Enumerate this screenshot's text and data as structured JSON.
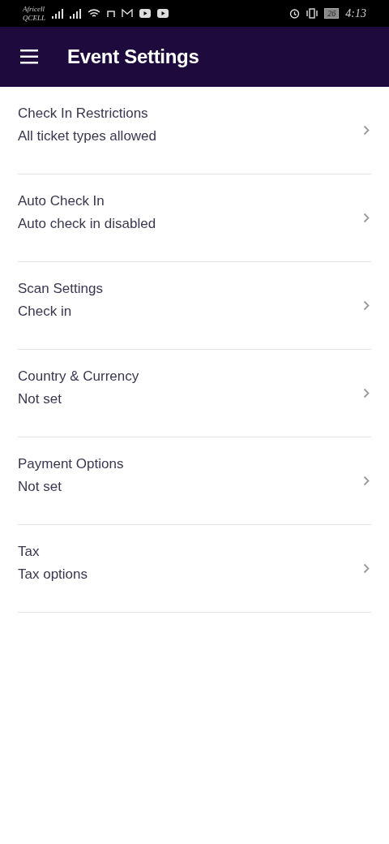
{
  "status_bar": {
    "carriers": [
      "Africell",
      "QCELL"
    ],
    "battery": "26",
    "time": "4:13"
  },
  "app_bar": {
    "title": "Event Settings"
  },
  "settings": [
    {
      "title": "Check In Restrictions",
      "value": "All ticket types allowed"
    },
    {
      "title": "Auto Check In",
      "value": "Auto check in disabled"
    },
    {
      "title": "Scan Settings",
      "value": "Check in"
    },
    {
      "title": "Country & Currency",
      "value": "Not set"
    },
    {
      "title": "Payment Options",
      "value": "Not set"
    },
    {
      "title": "Tax",
      "value": "Tax options"
    }
  ]
}
